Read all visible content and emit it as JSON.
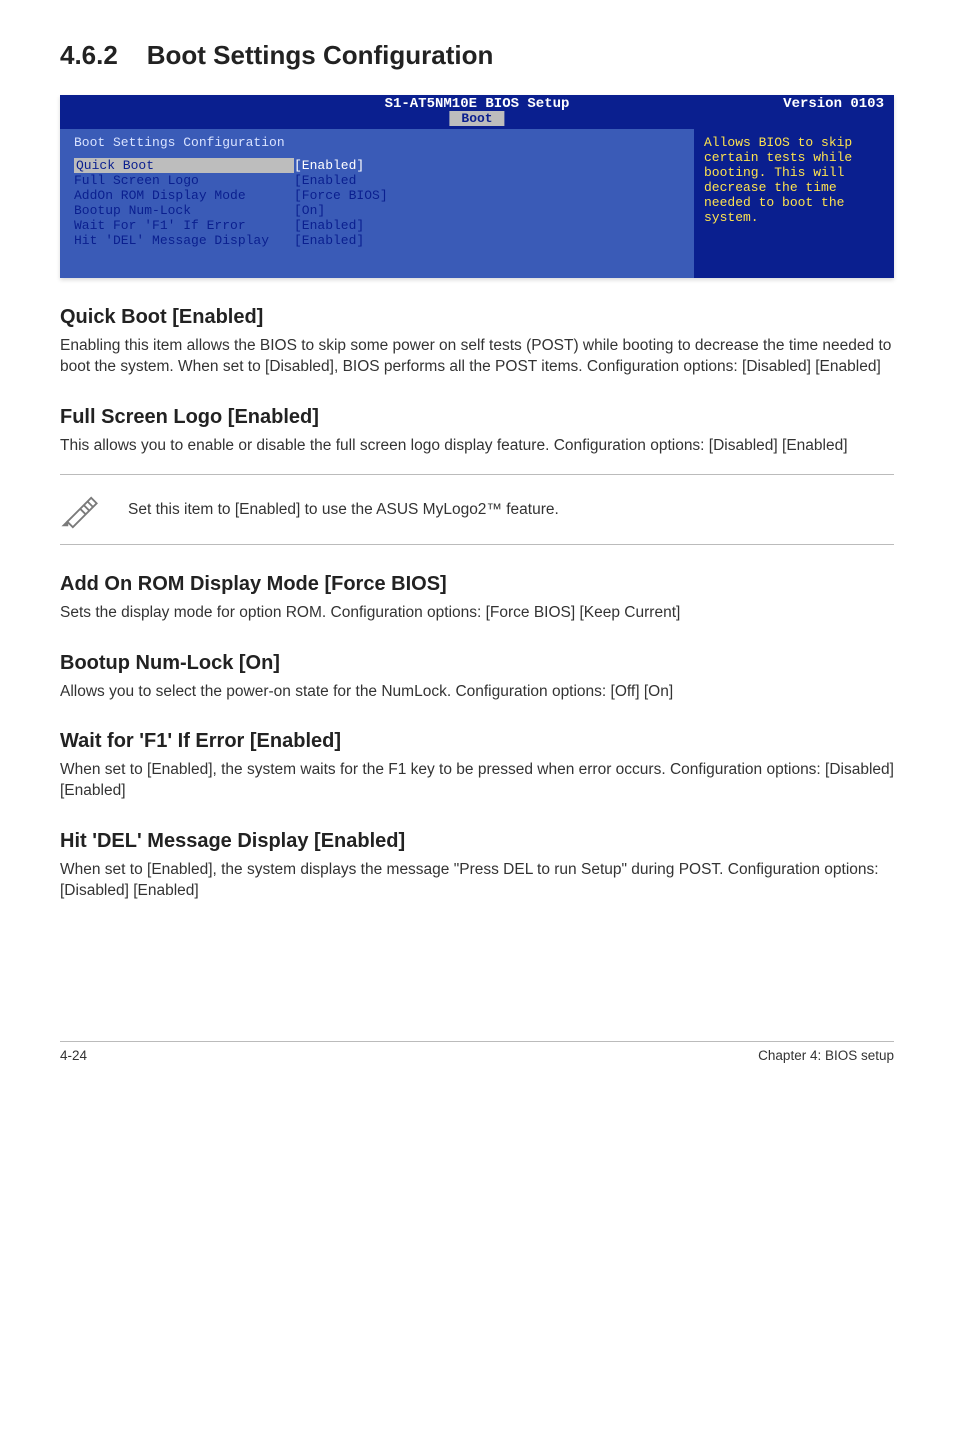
{
  "section": {
    "num": "4.6.2",
    "title": "Boot Settings Configuration"
  },
  "bios": {
    "product": "S1-AT5NM10E BIOS Setup",
    "tab": "Boot",
    "version": "Version 0103",
    "panel_title": "Boot Settings Configuration",
    "rows": [
      {
        "label": "Quick Boot",
        "value": "[Enabled]",
        "row_highlight": true
      },
      {
        "label": "Full Screen Logo",
        "value": "[Enabled"
      },
      {
        "label": "AddOn ROM Display Mode",
        "value": "[Force BIOS]"
      },
      {
        "label": "Bootup Num-Lock",
        "value": "[On]"
      },
      {
        "label": "Wait For 'F1' If Error",
        "value": "[Enabled]"
      },
      {
        "label": "Hit 'DEL' Message Display",
        "value": "[Enabled]"
      }
    ],
    "help": "Allows BIOS to skip certain tests while booting. This will decrease the time needed to boot the system."
  },
  "subs": {
    "quick_boot": {
      "h": "Quick Boot [Enabled]",
      "p": "Enabling this item allows the BIOS to skip some power on self tests (POST) while booting to decrease the time needed to boot the system. When set to [Disabled], BIOS performs all the POST items. Configuration options: [Disabled] [Enabled]"
    },
    "full_screen": {
      "h": "Full Screen Logo [Enabled]",
      "p": "This allows you to enable or disable the full screen logo display feature. Configuration options: [Disabled] [Enabled]"
    },
    "note": "Set this item to [Enabled] to use the ASUS MyLogo2™ feature.",
    "addon": {
      "h": "Add On ROM Display Mode [Force BIOS]",
      "p": "Sets the display mode for option ROM. Configuration options: [Force BIOS] [Keep Current]"
    },
    "numlock": {
      "h": "Bootup Num-Lock [On]",
      "p": "Allows you to select the power-on state for the NumLock. Configuration options: [Off] [On]"
    },
    "waitf1": {
      "h": "Wait for 'F1' If Error [Enabled]",
      "p": "When set to [Enabled], the system waits for the F1 key to be pressed when error occurs. Configuration options: [Disabled] [Enabled]"
    },
    "hitdel": {
      "h": "Hit 'DEL' Message Display [Enabled]",
      "p": "When set to [Enabled], the system displays the message \"Press DEL to run Setup\" during POST. Configuration options: [Disabled] [Enabled]"
    }
  },
  "footer": {
    "left": "4-24",
    "right": "Chapter 4: BIOS setup"
  }
}
